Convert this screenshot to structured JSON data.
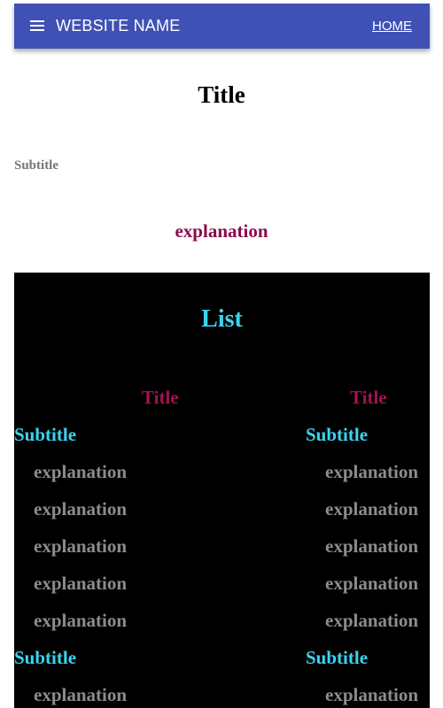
{
  "appbar": {
    "site_name": "WEBSITE NAME",
    "nav_home": "HOME",
    "menu_icon": "hamburger-menu-icon",
    "color": "#3f51b5"
  },
  "header": {
    "title": "Title",
    "subtitle": "Subtitle",
    "explanation": "explanation"
  },
  "list": {
    "heading": "List",
    "columns": [
      {
        "title": "Title",
        "groups": [
          {
            "subtitle": "Subtitle",
            "items": [
              "explanation",
              "explanation",
              "explanation",
              "explanation",
              "explanation"
            ]
          },
          {
            "subtitle": "Subtitle",
            "items": [
              "explanation"
            ]
          }
        ]
      },
      {
        "title": "Title",
        "groups": [
          {
            "subtitle": "Subtitle",
            "items": [
              "explanation",
              "explanation",
              "explanation",
              "explanation",
              "explanation"
            ]
          },
          {
            "subtitle": "Subtitle",
            "items": [
              "explanation"
            ]
          }
        ]
      }
    ]
  },
  "colors": {
    "list_background": "#000000",
    "accent_cyan": "#3ad4f0",
    "accent_crimson": "#a0144f",
    "muted_gray": "#8c8c8c"
  }
}
